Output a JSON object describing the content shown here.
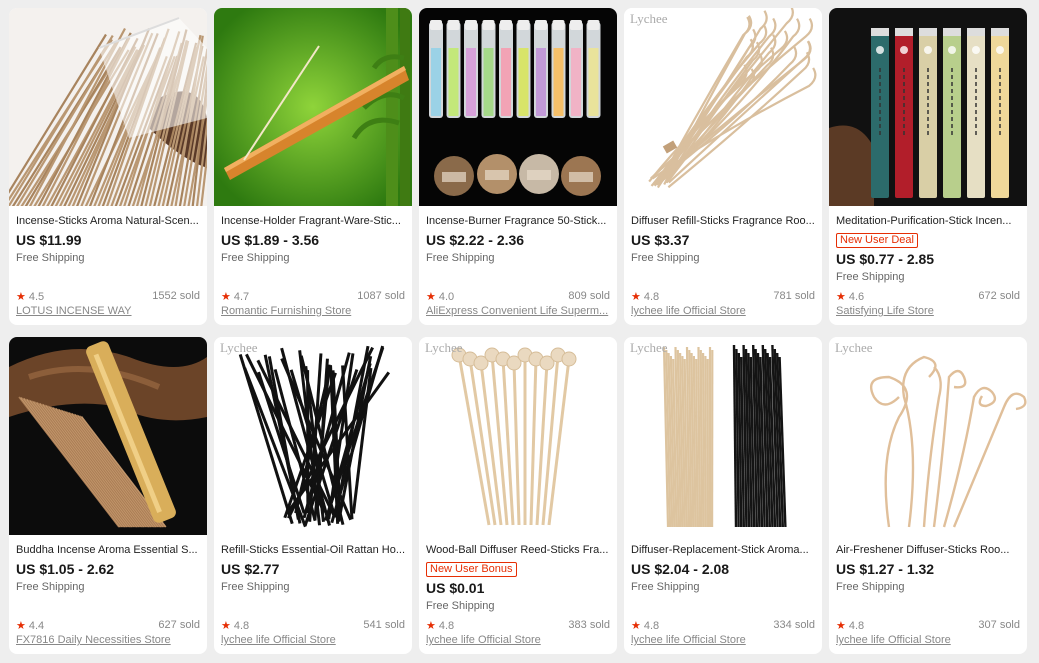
{
  "colors": {
    "accent": "#e62e04",
    "star": "#e62e04",
    "background": "#eeeeee"
  },
  "products": [
    {
      "title": "Incense-Sticks Aroma Natural-Scen...",
      "price": "US $11.99",
      "badge": "",
      "shipping": "Free Shipping",
      "rating": "4.5",
      "sold": "1552 sold",
      "store": "LOTUS INCENSE WAY",
      "image": "incense-bundle-bag"
    },
    {
      "title": "Incense-Holder Fragrant-Ware-Stic...",
      "price": "US $1.89 - 3.56",
      "badge": "",
      "shipping": "Free Shipping",
      "rating": "4.7",
      "sold": "1087 sold",
      "store": "Romantic Furnishing Store",
      "image": "wooden-holder-bamboo"
    },
    {
      "title": "Incense-Burner Fragrance 50-Stick...",
      "price": "US $2.22 - 2.36",
      "badge": "",
      "shipping": "Free Shipping",
      "rating": "4.0",
      "sold": "809 sold",
      "store": "AliExpress Convenient Life Superm...",
      "image": "colorful-tubes-rooms"
    },
    {
      "title": "Diffuser Refill-Sticks Fragrance Roo...",
      "price": "US $3.37",
      "badge": "",
      "shipping": "Free Shipping",
      "rating": "4.8",
      "sold": "781 sold",
      "store": "lychee life Official Store",
      "image": "curly-rattan-sticks",
      "brand": "Lychee"
    },
    {
      "title": "Meditation-Purification-Stick Incen...",
      "price": "US $0.77 - 2.85",
      "badge": "New User Deal",
      "shipping": "Free Shipping",
      "rating": "4.6",
      "sold": "672 sold",
      "store": "Satisfying Life Store",
      "image": "incense-tubes-dark"
    },
    {
      "title": "Buddha Incense Aroma Essential S...",
      "price": "US $1.05 - 2.62",
      "badge": "",
      "shipping": "Free Shipping",
      "rating": "4.4",
      "sold": "627 sold",
      "store": "FX7816 Daily Necessities Store",
      "image": "incense-tube-driftwood"
    },
    {
      "title": "Refill-Sticks Essential-Oil Rattan Ho...",
      "price": "US $2.77",
      "badge": "",
      "shipping": "Free Shipping",
      "rating": "4.8",
      "sold": "541 sold",
      "store": "lychee life Official Store",
      "image": "black-reed-sticks",
      "brand": "Lychee"
    },
    {
      "title": "Wood-Ball Diffuser Reed-Sticks Fra...",
      "price": "US $0.01",
      "badge": "New User Bonus",
      "shipping": "Free Shipping",
      "rating": "4.8",
      "sold": "383 sold",
      "store": "lychee life Official Store",
      "image": "wood-ball-sticks",
      "brand": "Lychee"
    },
    {
      "title": "Diffuser-Replacement-Stick Aroma...",
      "price": "US $2.04 - 2.08",
      "badge": "",
      "shipping": "Free Shipping",
      "rating": "4.8",
      "sold": "334 sold",
      "store": "lychee life Official Store",
      "image": "natural-and-black-sticks",
      "brand": "Lychee"
    },
    {
      "title": "Air-Freshener Diffuser-Sticks Roo...",
      "price": "US $1.27 - 1.32",
      "badge": "",
      "shipping": "Free Shipping",
      "rating": "4.8",
      "sold": "307 sold",
      "store": "lychee life Official Store",
      "image": "spiral-rattan-sticks",
      "brand": "Lychee"
    }
  ]
}
